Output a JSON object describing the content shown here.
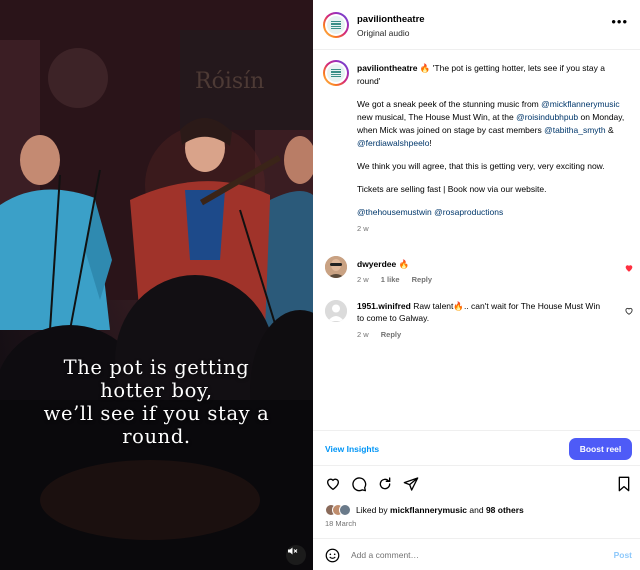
{
  "media": {
    "caption_lines": [
      "The pot is getting",
      "hotter boy,",
      "we’ll see if you stay a",
      "round."
    ]
  },
  "header": {
    "username": "paviliontheatre",
    "subtitle": "Original audio"
  },
  "post": {
    "username": "paviliontheatre",
    "line1_after_user": " 🔥 'The pot is getting hotter, lets see if you stay a round'",
    "p2_a": "We got a sneak peek of the stunning music from ",
    "mention_mick": "@mickflannerymusic",
    "p2_b": " new musical, The House Must Win, at the ",
    "mention_roisin": "@roisindubhpub",
    "p2_c": " on Monday, when Mick was joined on stage by cast members ",
    "mention_tabitha": "@tabitha_smyth",
    "p2_d": " & ",
    "mention_ferdia": "@ferdiawalshpeelo",
    "p2_e": "!",
    "p3": "We think you will agree, that this is getting very, very exciting now.",
    "p4": "Tickets are selling fast | Book now via our website.",
    "tag1": "@thehousemustwin",
    "tag2": "@rosaproductions",
    "time": "2 w"
  },
  "comments": [
    {
      "username": "dwyerdee",
      "text": " 🔥",
      "time": "2 w",
      "likes": "1 like",
      "reply": "Reply"
    },
    {
      "username": "1951.winifred",
      "text": " Raw talent🔥.. can't wait for The House Must Win to come to Galway.",
      "time": "2 w",
      "reply": "Reply"
    }
  ],
  "insights": {
    "view_label": "View Insights",
    "boost_label": "Boost reel"
  },
  "likes": {
    "prefix": "Liked by ",
    "user": "mickflannerymusic",
    "middle": " and ",
    "others": "98 others",
    "date": "18 March"
  },
  "add_comment": {
    "placeholder": "Add a comment…",
    "post_label": "Post"
  },
  "colors": {
    "accent_blue": "#0095f6",
    "boost_blue": "#4e5bf7",
    "like_red": "#ff3040",
    "link_navy": "#00376b"
  },
  "icons": [
    "volume-muted-icon",
    "more-icon",
    "heart-icon",
    "comment-icon",
    "share-icon",
    "bookmark-icon",
    "emoji-icon"
  ]
}
